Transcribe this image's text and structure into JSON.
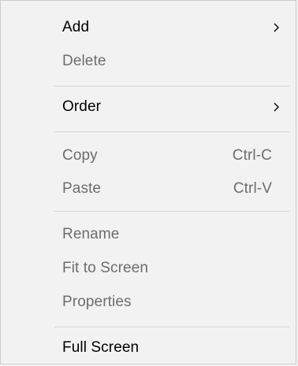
{
  "menu": {
    "add": "Add",
    "delete": "Delete",
    "order": "Order",
    "copy": "Copy",
    "copy_shortcut": "Ctrl-C",
    "paste": "Paste",
    "paste_shortcut": "Ctrl-V",
    "rename": "Rename",
    "fit_to_screen": "Fit to Screen",
    "properties": "Properties",
    "full_screen": "Full Screen"
  },
  "icons": {
    "submenu": "chevron-right-icon"
  },
  "colors": {
    "background": "#f2f2f2",
    "enabled_text": "#000000",
    "disabled_text": "#6d6d6d",
    "separator": "#d4d4d4"
  }
}
